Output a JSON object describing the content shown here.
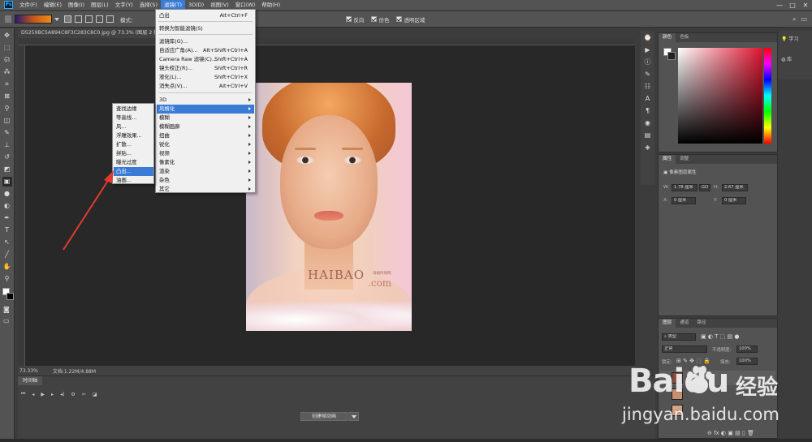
{
  "app": {
    "logo": "Ps"
  },
  "menubar": {
    "items": [
      "文件(F)",
      "编辑(E)",
      "图像(I)",
      "图层(L)",
      "文字(Y)",
      "选择(S)",
      "滤镜(T)",
      "3D(D)",
      "视图(V)",
      "窗口(W)",
      "帮助(H)"
    ],
    "active": "滤镜(T)",
    "win_min": "—",
    "win_max": "□",
    "win_close": "✕"
  },
  "options": {
    "mode_label": "模式：",
    "reverse_label": "反向",
    "dither_label": "仿色",
    "transparency_label": "透明区域"
  },
  "document": {
    "tab_title": "D5259BC5A894C8F3C283C8C0.jpg @ 73.3% (图层 2 拷贝",
    "zoom": "73.33%",
    "doc_info": "文档:1.22M/4.88M"
  },
  "photo": {
    "watermark": "HAIBAO",
    "watermark_suffix": ".com",
    "watermark_small": "海报时尚网"
  },
  "filter_menu": {
    "items": [
      {
        "label": "凸出",
        "shortcut": "Alt+Ctrl+F"
      },
      {
        "label": "转换为智能滤镜(S)",
        "shortcut": ""
      },
      {
        "label": "滤镜库(G)...",
        "shortcut": ""
      },
      {
        "label": "自适应广角(A)...",
        "shortcut": "Alt+Shift+Ctrl+A"
      },
      {
        "label": "Camera Raw 滤镜(C)...",
        "shortcut": "Shift+Ctrl+A"
      },
      {
        "label": "镜头校正(R)...",
        "shortcut": "Shift+Ctrl+R"
      },
      {
        "label": "液化(L)...",
        "shortcut": "Shift+Ctrl+X"
      },
      {
        "label": "消失点(V)...",
        "shortcut": "Alt+Ctrl+V"
      },
      {
        "label": "3D",
        "shortcut": ""
      },
      {
        "label": "风格化",
        "shortcut": ""
      },
      {
        "label": "模糊",
        "shortcut": ""
      },
      {
        "label": "模糊画廊",
        "shortcut": ""
      },
      {
        "label": "扭曲",
        "shortcut": ""
      },
      {
        "label": "锐化",
        "shortcut": ""
      },
      {
        "label": "视频",
        "shortcut": ""
      },
      {
        "label": "像素化",
        "shortcut": ""
      },
      {
        "label": "渲染",
        "shortcut": ""
      },
      {
        "label": "杂色",
        "shortcut": ""
      },
      {
        "label": "其它",
        "shortcut": ""
      }
    ]
  },
  "stylize_menu": {
    "items": [
      "查找边缘",
      "等高线...",
      "风...",
      "浮雕效果...",
      "扩散...",
      "拼贴...",
      "曝光过度",
      "凸出...",
      "油画..."
    ],
    "highlighted": "凸出..."
  },
  "panels": {
    "color_tabs": [
      "颜色",
      "色板"
    ],
    "props_tabs": [
      "属性",
      "调整"
    ],
    "props_sub": "像素图层属性",
    "w_label": "W:",
    "w_value": "1.78 厘米",
    "go": "GO",
    "h_label": "H:",
    "h_value": "2.67 厘米",
    "x_label": "X:",
    "x_value": "0 厘米",
    "y_label": "Y:",
    "y_value": "0 厘米",
    "layers_tabs": [
      "图层",
      "通道",
      "路径"
    ],
    "layers_kind": "类型",
    "layers_mode": "正常",
    "opacity_label": "不透明度:",
    "opacity_value": "100%",
    "lock_label": "锁定:",
    "fill_label": "填充:",
    "fill_value": "100%",
    "learn_label": "学习",
    "library_label": "库"
  },
  "timeline": {
    "tab": "时间轴",
    "create_button": "创建帧动画"
  },
  "baidu": {
    "brand": "Baidu",
    "cn": "经验",
    "url": "jingyan.baidu.com"
  },
  "colors": {
    "accent": "#3a7bd5",
    "ui_bg": "#535353",
    "canvas": "#282828"
  }
}
